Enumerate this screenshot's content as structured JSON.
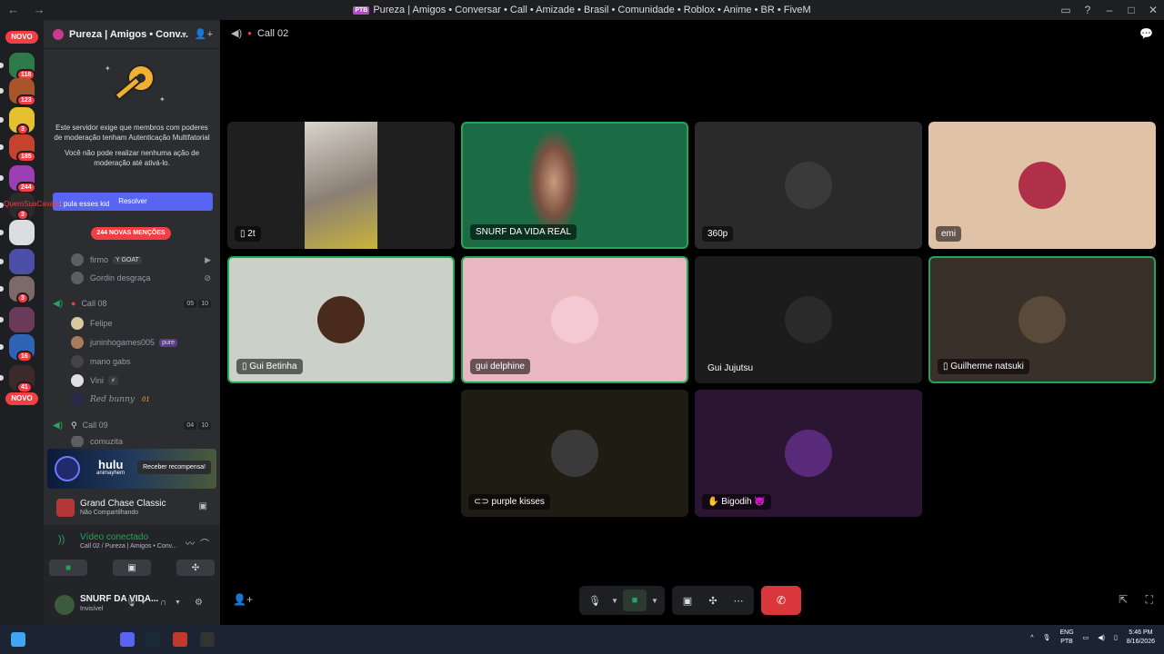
{
  "window": {
    "title": "Pureza | Amigos • Conversar • Call • Amizade • Brasil • Comunidade • Roblox • Anime • BR • FiveM",
    "logo_text": "PTB",
    "nav": "← →"
  },
  "guilds": [
    {
      "badge": "NOVO",
      "color": "#f23f43"
    },
    {
      "badge": "118",
      "color": "#2f7a4a"
    },
    {
      "badge": "123",
      "color": "#a8552b"
    },
    {
      "badge": "3",
      "color": "#e6c12e"
    },
    {
      "badge": "185",
      "color": "#c5422f"
    },
    {
      "badge": "244",
      "color": "#9b3fb2"
    },
    {
      "badge": "3",
      "color": "#2b2b2b"
    },
    {
      "badge": "",
      "color": "#dbdee1"
    },
    {
      "badge": "",
      "color": "#4b4fa8"
    },
    {
      "badge": "3",
      "color": "#7a6a6a"
    },
    {
      "badge": "",
      "color": "#6b3a5a"
    },
    {
      "badge": "16",
      "color": "#2f63b5"
    },
    {
      "badge": "41",
      "color": "#3a2a2a"
    },
    {
      "badge": "NOVO",
      "color": "#f23f43"
    }
  ],
  "server": {
    "name": "Pureza | Amigos • Conv...",
    "mfa_text1": "Este servidor exige que membros com poderes de moderação tenham Autenticação Multifatorial",
    "mfa_text2": "Você não pode realizar nenhuma ação de moderação até ativá-lo.",
    "resolve_button": "Resolver",
    "overlay_user": "QueroSuaCavala",
    "overlay_msg": ": pula esses kid",
    "mentions_badge": "244 NOVAS MENÇÕES"
  },
  "channel_members_top": [
    {
      "name": "firmo",
      "tag": "Y GOAT"
    },
    {
      "name": "Gordin desgraça",
      "tag": ""
    }
  ],
  "call08": {
    "name": "Call 08",
    "count_a": "05",
    "count_b": "10",
    "members": [
      {
        "name": "Felipe",
        "tag": ""
      },
      {
        "name": "juninhogames005",
        "tag": "pure"
      },
      {
        "name": "mano gabs",
        "tag": ""
      },
      {
        "name": "Vini",
        "tag": "⚡"
      },
      {
        "name": "Red bunny",
        "tag": "01"
      }
    ]
  },
  "call09": {
    "name": "Call 09",
    "count_a": "04",
    "count_b": "10",
    "first_member": "comuzita"
  },
  "hulu": {
    "logo": "hulu",
    "sub": "animayhem",
    "button": "Receber recompensa!"
  },
  "activity": {
    "game": "Grand Chase Classic",
    "status": "Não Compartilhando"
  },
  "voice": {
    "status": "Vídeo conectado",
    "channel": "Call 02 / Pureza | Amigos • Conv..."
  },
  "user": {
    "name": "SNURF DA VIDA...",
    "status": "Invisível"
  },
  "call": {
    "channel_name": "Call 02"
  },
  "tiles": [
    {
      "name": "2t",
      "bg": "#1f1f1f",
      "icon": "phone",
      "avatar": "",
      "active": false
    },
    {
      "name": "SNURF DA VIDA REAL",
      "bg": "#1b6b45",
      "icon": "",
      "avatar": "",
      "active": true
    },
    {
      "name": "360p",
      "bg": "#2a2a2a",
      "icon": "",
      "avatar": "#3a3a3a",
      "active": false
    },
    {
      "name": "emi",
      "bg": "#e0c2a6",
      "icon": "",
      "avatar": "#b0304a",
      "active": false
    },
    {
      "name": "Gui Betinha",
      "bg": "#cbd0c9",
      "icon": "phone",
      "avatar": "#4a2a1a",
      "active": true
    },
    {
      "name": "gui delphine",
      "bg": "#e8b7bf",
      "icon": "",
      "avatar": "#f4c9d3",
      "active": true
    },
    {
      "name": "Gui Jujutsu",
      "bg": "#1c1c1c",
      "icon": "",
      "avatar": "#2a2a2a",
      "active": false
    },
    {
      "name": "Guilherme natsuki",
      "bg": "#3a302a",
      "icon": "phone",
      "avatar": "#5a4a3a",
      "active": true
    },
    {
      "name": "purple kisses",
      "bg": "#1f1c14",
      "icon": "link",
      "avatar": "#3a3a3a",
      "active": false
    },
    {
      "name": "Bigodih 👿",
      "bg": "#2a1632",
      "icon": "hand",
      "avatar": "#5a2a7a",
      "active": false
    }
  ],
  "controls": {
    "mic": "mic-icon",
    "camera": "camera-icon",
    "share": "screen-share-icon",
    "activities": "activities-icon",
    "more": "more-icon",
    "hangup": "hangup-icon"
  },
  "taskbar": {
    "lang1": "ENG",
    "lang2": "PTB",
    "time": "5:46 PM",
    "date": "8/16/2026"
  }
}
